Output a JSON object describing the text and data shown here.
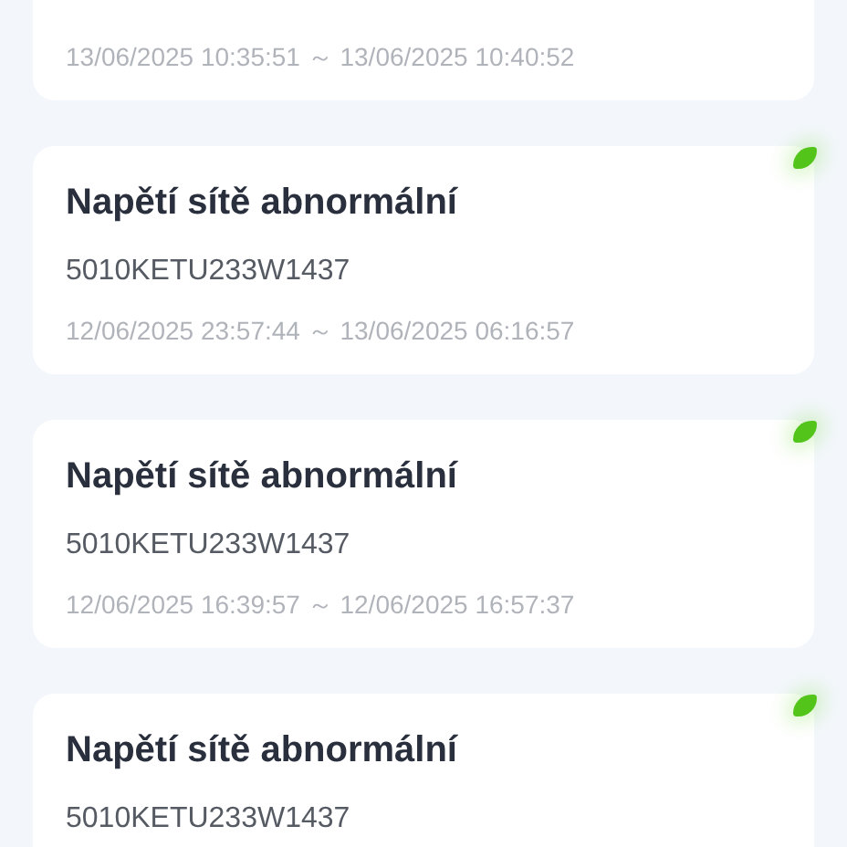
{
  "alarms": [
    {
      "time_range": "13/06/2025 10:35:51 ～ 13/06/2025 10:40:52"
    },
    {
      "title": "Napětí sítě abnormální",
      "serial": "5010KETU233W1437",
      "time_range": "12/06/2025 23:57:44 ～ 13/06/2025 06:16:57",
      "color": "#52c41a"
    },
    {
      "title": "Napětí sítě abnormální",
      "serial": "5010KETU233W1437",
      "time_range": "12/06/2025 16:39:57 ～ 12/06/2025 16:57:37",
      "color": "#52c41a"
    },
    {
      "title": "Napětí sítě abnormální",
      "serial": "5010KETU233W1437",
      "color": "#52c41a"
    }
  ]
}
